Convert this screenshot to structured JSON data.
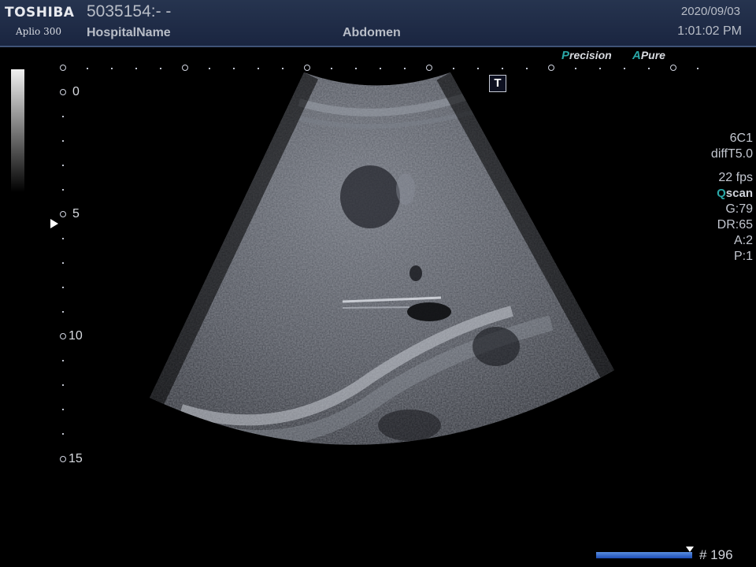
{
  "header": {
    "brand": "TOSHIBA",
    "model": "Aplio 300",
    "patient_id": "5035154:- -",
    "hospital": "HospitalName",
    "exam": "Abdomen",
    "date": "2020/09/03",
    "time": "1:01:02 PM"
  },
  "badges": {
    "precision_accent": "P",
    "precision_rest": "recision",
    "apure_accent": "A",
    "apure_rest": "Pure"
  },
  "depth_scale": {
    "labels": [
      "0",
      "5",
      "10",
      "15"
    ]
  },
  "t_marker": "T",
  "params": {
    "probe": "6C1",
    "mode": "diffT5.0",
    "fps": "22 fps",
    "qscan_accent": "Q",
    "qscan_rest": "scan",
    "gain": "G:79",
    "dynamic_range": "DR:65",
    "a": "A:2",
    "p": "P:1"
  },
  "cine": {
    "frame": "# 196"
  },
  "colors": {
    "header_bg": "#1f2c47",
    "accent_teal": "#2aa7a7",
    "cine_blue": "#2a62cc"
  }
}
